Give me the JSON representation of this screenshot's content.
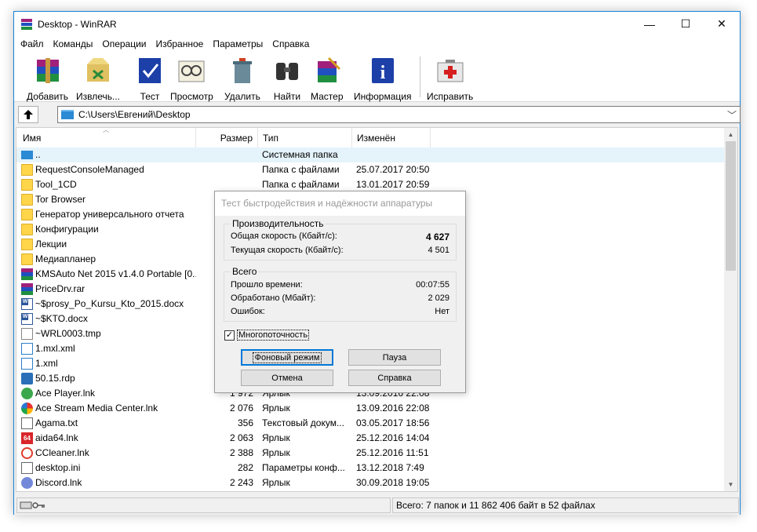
{
  "window": {
    "title": "Desktop - WinRAR",
    "minimize": "—",
    "maximize": "☐",
    "close": "✕"
  },
  "menu": [
    "Файл",
    "Команды",
    "Операции",
    "Избранное",
    "Параметры",
    "Справка"
  ],
  "toolbar": [
    {
      "label": "Добавить",
      "icon": "add-archive-icon"
    },
    {
      "label": "Извлечь...",
      "icon": "extract-icon"
    },
    {
      "label": "Тест",
      "icon": "test-icon"
    },
    {
      "label": "Просмотр",
      "icon": "view-icon"
    },
    {
      "label": "Удалить",
      "icon": "delete-icon"
    },
    {
      "label": "Найти",
      "icon": "find-icon"
    },
    {
      "label": "Мастер",
      "icon": "wizard-icon"
    },
    {
      "label": "Информация",
      "icon": "info-icon"
    },
    {
      "label": "Исправить",
      "icon": "repair-icon"
    }
  ],
  "address": {
    "path": "C:\\Users\\Евгений\\Desktop"
  },
  "columns": {
    "name": "Имя",
    "size": "Размер",
    "type": "Тип",
    "modified": "Изменён"
  },
  "files": [
    {
      "name": "..",
      "size": "",
      "type": "Системная папка",
      "modified": "",
      "icon": "up"
    },
    {
      "name": "RequestConsoleManaged",
      "size": "",
      "type": "Папка с файлами",
      "modified": "25.07.2017 20:50",
      "icon": "folder"
    },
    {
      "name": "Tool_1CD",
      "size": "",
      "type": "Папка с файлами",
      "modified": "13.01.2017 20:59",
      "icon": "folder"
    },
    {
      "name": "Tor Browser",
      "size": "",
      "type": "",
      "modified": "",
      "icon": "folder"
    },
    {
      "name": "Генератор универсального отчета",
      "size": "",
      "type": "",
      "modified": "",
      "icon": "folder"
    },
    {
      "name": "Конфигурации",
      "size": "",
      "type": "",
      "modified": "",
      "icon": "folder"
    },
    {
      "name": "Лекции",
      "size": "",
      "type": "",
      "modified": "",
      "icon": "folder"
    },
    {
      "name": "Медиапланер",
      "size": "",
      "type": "",
      "modified": "",
      "icon": "folder"
    },
    {
      "name": "KMSAuto Net 2015 v1.4.0 Portable [0...",
      "size": "",
      "type": "",
      "modified": "",
      "icon": "rar"
    },
    {
      "name": "PriceDrv.rar",
      "size": "",
      "type": "",
      "modified": "",
      "icon": "rar"
    },
    {
      "name": "~$prosy_Po_Kursu_Kto_2015.docx",
      "size": "",
      "type": "",
      "modified": "",
      "icon": "doc"
    },
    {
      "name": "~$KTO.docx",
      "size": "",
      "type": "",
      "modified": "",
      "icon": "doc"
    },
    {
      "name": "~WRL0003.tmp",
      "size": "",
      "type": "",
      "modified": "",
      "icon": "file"
    },
    {
      "name": "1.mxl.xml",
      "size": "",
      "type": "",
      "modified": "",
      "icon": "xml"
    },
    {
      "name": "1.xml",
      "size": "",
      "type": "",
      "modified": "",
      "icon": "xml"
    },
    {
      "name": "50.15.rdp",
      "size": "",
      "type": "",
      "modified": "",
      "icon": "rdp"
    },
    {
      "name": "Ace Player.lnk",
      "size": "1 972",
      "type": "Ярлык",
      "modified": "13.09.2016 22:08",
      "icon": "ace"
    },
    {
      "name": "Ace Stream Media Center.lnk",
      "size": "2 076",
      "type": "Ярлык",
      "modified": "13.09.2016 22:08",
      "icon": "acestream"
    },
    {
      "name": "Agama.txt",
      "size": "356",
      "type": "Текстовый докум...",
      "modified": "03.05.2017 18:56",
      "icon": "txt"
    },
    {
      "name": "aida64.lnk",
      "size": "2 063",
      "type": "Ярлык",
      "modified": "25.12.2016 14:04",
      "icon": "aida"
    },
    {
      "name": "CCleaner.lnk",
      "size": "2 388",
      "type": "Ярлык",
      "modified": "25.12.2016 11:51",
      "icon": "cc"
    },
    {
      "name": "desktop.ini",
      "size": "282",
      "type": "Параметры конф...",
      "modified": "13.12.2018 7:49",
      "icon": "ini"
    },
    {
      "name": "Discord.lnk",
      "size": "2 243",
      "type": "Ярлык",
      "modified": "30.09.2018 19:05",
      "icon": "discord"
    }
  ],
  "status": {
    "summary": "Всего: 7 папок и 11 862 406 байт в 52 файлах"
  },
  "dialog": {
    "title": "Тест быстродействия и надёжности аппаратуры",
    "speed_group": "Производительность",
    "total_speed_label": "Общая скорость (Кбайт/с):",
    "total_speed_value": "4 627",
    "current_speed_label": "Текущая скорость (Кбайт/с):",
    "current_speed_value": "4 501",
    "total_group": "Всего",
    "elapsed_label": "Прошло времени:",
    "elapsed_value": "00:07:55",
    "processed_label": "Обработано (Мбайт):",
    "processed_value": "2 029",
    "errors_label": "Ошибок:",
    "errors_value": "Нет",
    "multithread_label": "Многопоточность",
    "multithread_checked": "✓",
    "background_button": "Фоновый режим",
    "pause_button": "Пауза",
    "cancel_button": "Отмена",
    "help_button": "Справка"
  }
}
